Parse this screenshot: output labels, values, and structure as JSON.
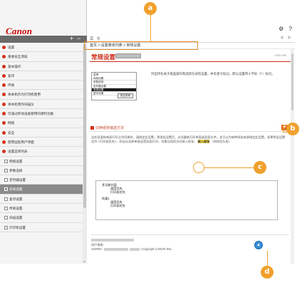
{
  "app": {
    "logo": "Canon"
  },
  "sidebar": {
    "toolbar": {
      "expand": "+",
      "collapse": "−"
    },
    "items": [
      {
        "label": "设置",
        "kind": "bullet"
      },
      {
        "label": "重要安全须知",
        "kind": "bullet"
      },
      {
        "label": "基本操作",
        "kind": "bullet"
      },
      {
        "label": "复印",
        "kind": "bullet"
      },
      {
        "label": "传真",
        "kind": "bullet"
      },
      {
        "label": "将本机作为打印机使用",
        "kind": "bullet"
      },
      {
        "label": "将本机用作扫描仪",
        "kind": "bullet"
      },
      {
        "label": "可通过移动设备使用的便利功能",
        "kind": "bullet"
      },
      {
        "label": "网络",
        "kind": "bullet"
      },
      {
        "label": "安全",
        "kind": "bullet"
      },
      {
        "label": "使用远程用户界面",
        "kind": "bullet"
      },
      {
        "label": "设置菜单列表",
        "kind": "bullet"
      },
      {
        "label": "网络设置",
        "kind": "sub"
      },
      {
        "label": "参数选择",
        "kind": "sub"
      },
      {
        "label": "定时器设置",
        "kind": "sub"
      },
      {
        "label": "常规设置",
        "kind": "sub",
        "active": true
      },
      {
        "label": "复印设置",
        "kind": "sub"
      },
      {
        "label": "传真设置",
        "kind": "sub"
      },
      {
        "label": "扫描设置",
        "kind": "sub"
      },
      {
        "label": "打印机设置",
        "kind": "sub"
      }
    ]
  },
  "header": {
    "gear_glyph": "⚙",
    "help_glyph": "?"
  },
  "topbar": {
    "list_glyph": "☰",
    "search_glyph": "🔍",
    "prev": "<",
    "next": ">"
  },
  "breadcrumb": {
    "text": "首页 > 设置菜单列表 > 常规设置"
  },
  "page": {
    "title": "常规设置",
    "doc_code": "1SE5-050",
    "intro": "列出所有关于纸盒操作和选择方式的设置，并有星号标记。默认设置用十字标（†）标识。",
    "panel": {
      "header": "菜单",
      "rows": [
        "网络设置",
        "参数选择",
        "定时器设置",
        "常规设置",
        "复印设置"
      ],
      "selected_index": 3,
      "button": "前往菜单"
    },
    "section_title": "切换纸张输送方法",
    "section_toggle": "▼",
    "body_prefix": "当在双面和单面打印之间切换时，请指定此设置。更改此设置后，必须重新打印单面或双面文件。也可以为每种纸张来源指定此设置。如果将此设置设为 <打印面优先>，则无论选择单面还是双面打印，均需以相同方向装入纸张。",
    "body_highlight": "装入纸张",
    "body_suffix": "（例如信头纸）",
    "example": {
      "group1_title": "多功能托盘",
      "group1_options": [
        "速度优先",
        "打印面优先"
      ],
      "group2_title": "纸盒1",
      "group2_options": [
        "速度优先",
        "打印面优先"
      ]
    },
    "footer_line1": "用户指南",
    "footer_line2_prefix": "USRMA-",
    "footer_copyright": "Copyright CANON INC."
  },
  "back_to_top": "▲",
  "callouts": [
    "a",
    "b",
    "c",
    "d"
  ]
}
